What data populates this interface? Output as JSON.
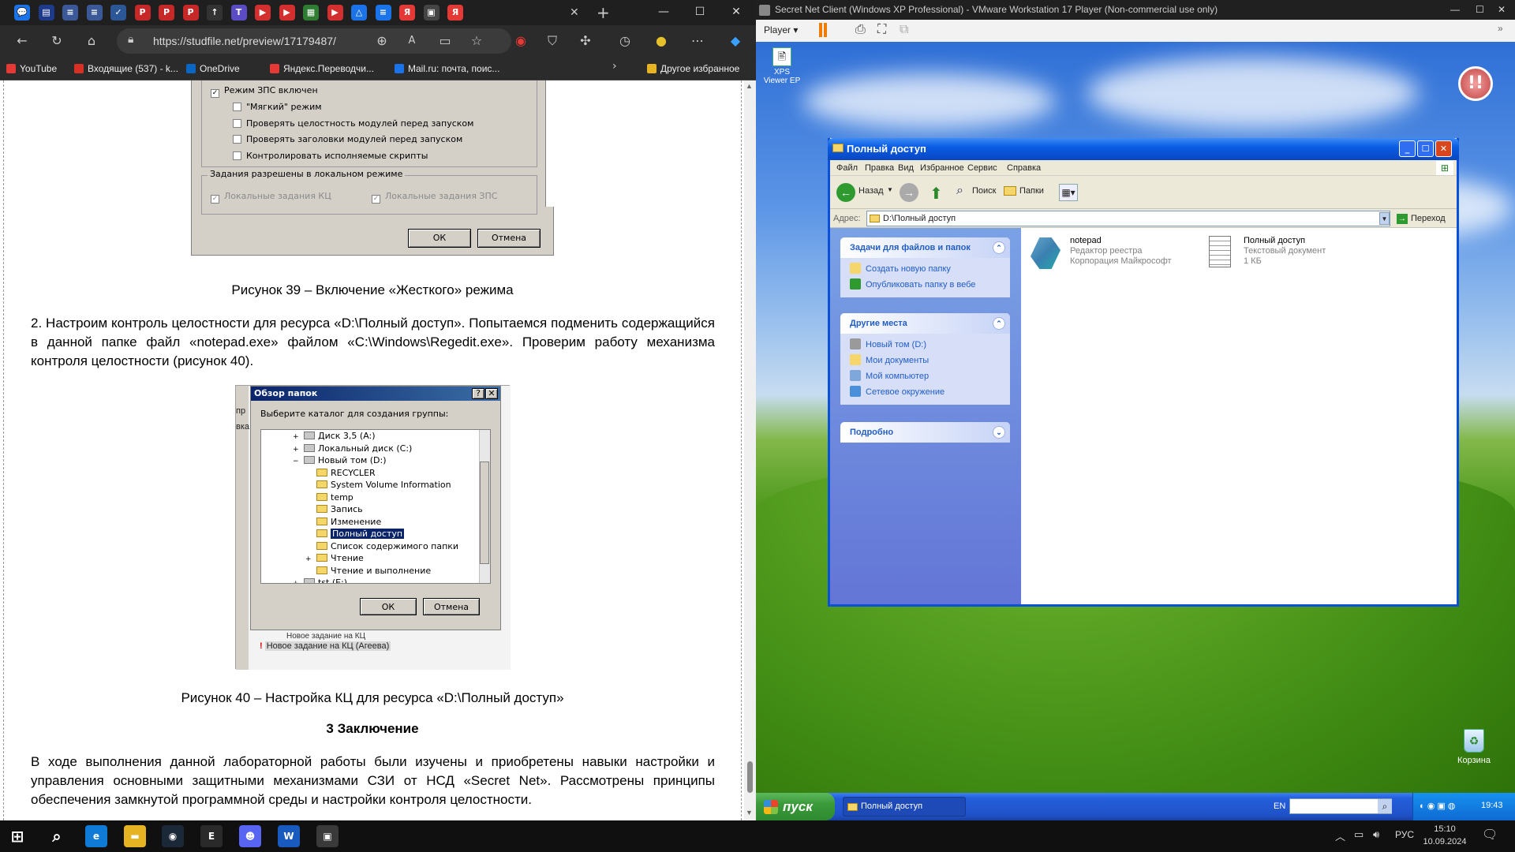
{
  "edge": {
    "tabs": [
      {
        "icon": "chat-icon",
        "color": "#1a73e8",
        "glyph": "💬"
      },
      {
        "icon": "studfile-icon",
        "color": "#1e3a8a",
        "glyph": "▤"
      },
      {
        "icon": "doc-icon",
        "color": "#3b5998",
        "glyph": "≡"
      },
      {
        "icon": "doc-icon",
        "color": "#3b5998",
        "glyph": "≡"
      },
      {
        "icon": "check-icon",
        "color": "#2b5797",
        "glyph": "✓"
      },
      {
        "icon": "pdf-icon",
        "color": "#c62828",
        "glyph": "P"
      },
      {
        "icon": "pdf-icon",
        "color": "#c62828",
        "glyph": "P"
      },
      {
        "icon": "pdf-icon",
        "color": "#c62828",
        "glyph": "P"
      },
      {
        "icon": "arrow-icon",
        "color": "#333333",
        "glyph": "↑"
      },
      {
        "icon": "t-icon",
        "color": "#5b4bc4",
        "glyph": "T"
      },
      {
        "icon": "youtube-icon",
        "color": "#d32f2f",
        "glyph": "▶"
      },
      {
        "icon": "youtube-icon",
        "color": "#d32f2f",
        "glyph": "▶"
      },
      {
        "icon": "grid-icon",
        "color": "#2e7d32",
        "glyph": "▦"
      },
      {
        "icon": "youtube-icon",
        "color": "#d32f2f",
        "glyph": "▶"
      },
      {
        "icon": "drive-icon",
        "color": "#1a73e8",
        "glyph": "△"
      },
      {
        "icon": "docs-icon",
        "color": "#1a73e8",
        "glyph": "≡"
      },
      {
        "icon": "yandex-icon",
        "color": "#e53935",
        "glyph": "Я"
      },
      {
        "icon": "calendar-icon",
        "color": "#444444",
        "glyph": "▣"
      },
      {
        "icon": "yandex-icon",
        "color": "#e53935",
        "glyph": "Я"
      }
    ],
    "url": "https://studfile.net/preview/17179487/",
    "bookmarks": [
      {
        "label": "YouTube",
        "color": "#e53935"
      },
      {
        "label": "Входящие (537) - k...",
        "color": "#d93025"
      },
      {
        "label": "OneDrive",
        "color": "#0a66c2"
      },
      {
        "label": "Яндекс.Переводчи...",
        "color": "#e53935"
      },
      {
        "label": "Mail.ru: почта, поис...",
        "color": "#1a73e8"
      }
    ],
    "other_bookmarks": "Другое избранное"
  },
  "document": {
    "fig39": {
      "opt_main": "Режим ЗПС включен",
      "opt_soft": "\"Мягкий\" режим",
      "opt_integrity": "Проверять целостность модулей перед запуском",
      "opt_headers": "Проверять заголовки модулей перед запуском",
      "opt_scripts": "Контролировать исполняемые скрипты",
      "group_title": "Задания разрешены в локальном режиме",
      "local_kc": "Локальные задания КЦ",
      "local_zps": "Локальные задания ЗПС",
      "ok": "ОК",
      "cancel": "Отмена"
    },
    "caption39": "Рисунок 39 – Включение «Жесткого» режима",
    "para2": "2. Настроим контроль целостности для ресурса «D:\\Полный доступ». Попытаемся подменить содержащийся в данной папке файл «notepad.exe» файлом «C:\\Windows\\Regedit.exe». Проверим работу механизма контроля целостности (рисунок 40).",
    "fig40": {
      "title": "Обзор папок",
      "prompt": "Выберите каталог для создания группы:",
      "tree": [
        {
          "label": "Диск 3,5 (A:)",
          "level": 1,
          "sign": "+"
        },
        {
          "label": "Локальный диск (C:)",
          "level": 1,
          "sign": "+"
        },
        {
          "label": "Новый том (D:)",
          "level": 1,
          "sign": "−"
        },
        {
          "label": "RECYCLER",
          "level": 2,
          "sign": ""
        },
        {
          "label": "System Volume Information",
          "level": 2,
          "sign": ""
        },
        {
          "label": "temp",
          "level": 2,
          "sign": ""
        },
        {
          "label": "Запись",
          "level": 2,
          "sign": ""
        },
        {
          "label": "Изменение",
          "level": 2,
          "sign": ""
        },
        {
          "label": "Полный доступ",
          "level": 2,
          "sign": "",
          "selected": true
        },
        {
          "label": "Список содержимого папки",
          "level": 2,
          "sign": ""
        },
        {
          "label": "Чтение",
          "level": 2,
          "sign": "+"
        },
        {
          "label": "Чтение и выполнение",
          "level": 2,
          "sign": ""
        },
        {
          "label": "tst (E:)",
          "level": 1,
          "sign": "+"
        }
      ],
      "ok": "ОК",
      "cancel": "Отмена",
      "bg_left1": "пр",
      "bg_left2": "вка",
      "bg_task_partial": "Новое задание на КЦ",
      "bg_task": "Новое задание на КЦ (Агеева)"
    },
    "caption40": "Рисунок 40 – Настройка КЦ для ресурса «D:\\Полный доступ»",
    "heading3": "3 Заключение",
    "para3": "В ходе выполнения данной лабораторной работы были изучены и приобретены навыки настройки и управления основными защитными механизмами СЗИ от НСД «Secret Net». Рассмотрены принципы обеспечения замкнутой программной среды и настройки контроля целостности."
  },
  "vmware": {
    "title": "Secret Net Client (Windows XP Professional) - VMware Workstation 17 Player (Non-commercial use only)",
    "player_label": "Player"
  },
  "xp": {
    "desktop_icon_xps": "XPS Viewer EP",
    "desktop_icon_bin": "Корзина",
    "explorer": {
      "title": "Полный доступ",
      "menu": [
        "Файл",
        "Правка",
        "Вид",
        "Избранное",
        "Сервис",
        "Справка"
      ],
      "back": "Назад",
      "search": "Поиск",
      "folders": "Папки",
      "address_label": "Адрес:",
      "address": "D:\\Полный доступ",
      "go": "Переход",
      "tasks_title": "Задачи для файлов и папок",
      "tasks": [
        "Создать новую папку",
        "Опубликовать папку в вебе"
      ],
      "places_title": "Другие места",
      "places": [
        "Новый том (D:)",
        "Мои документы",
        "Мой компьютер",
        "Сетевое окружение"
      ],
      "details_title": "Подробно",
      "files": [
        {
          "name": "notepad",
          "line1": "Редактор реестра",
          "line2": "Корпорация Майкрософт",
          "icon": "registry-icon"
        },
        {
          "name": "Полный доступ",
          "line1": "Текстовый документ",
          "line2": "1 КБ",
          "icon": "text-document-icon"
        }
      ]
    },
    "taskbar": {
      "start": "пуск",
      "task": "Полный доступ",
      "lang": "EN",
      "clock": "19:43"
    }
  },
  "win10": {
    "apps": [
      {
        "icon": "start-icon",
        "color": "#101010",
        "glyph": "⊞"
      },
      {
        "icon": "search-icon",
        "color": "#101010",
        "glyph": "⌕"
      },
      {
        "icon": "edge-icon",
        "color": "#0f7bd6",
        "glyph": "e"
      },
      {
        "icon": "file-explorer-icon",
        "color": "#e6b422",
        "glyph": "▬"
      },
      {
        "icon": "steam-icon",
        "color": "#1b2838",
        "glyph": "◉"
      },
      {
        "icon": "epic-games-icon",
        "color": "#2a2a2a",
        "glyph": "E"
      },
      {
        "icon": "discord-icon",
        "color": "#5865f2",
        "glyph": "☻"
      },
      {
        "icon": "word-icon",
        "color": "#185abd",
        "glyph": "W"
      },
      {
        "icon": "vmware-icon",
        "color": "#3a3a3a",
        "glyph": "▣"
      }
    ],
    "lang": "РУС",
    "time": "15:10",
    "date": "10.09.2024"
  }
}
